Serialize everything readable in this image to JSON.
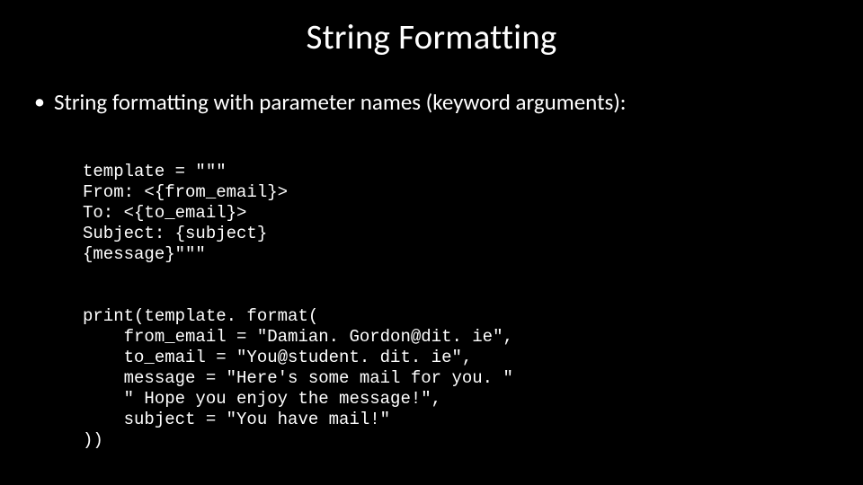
{
  "title": "String Formatting",
  "bullet": "String formatting with parameter names (keyword arguments):",
  "code": {
    "l1": "template = \"\"\"",
    "l2": "From: <{from_email}>",
    "l3": "To: <{to_email}>",
    "l4": "Subject: {subject}",
    "l5": "{message}\"\"\"",
    "l6": "print(template. format(",
    "l7": "    from_email = \"Damian. Gordon@dit. ie\",",
    "l8": "    to_email = \"You@student. dit. ie\",",
    "l9": "    message = \"Here's some mail for you. \"",
    "l10": "    \" Hope you enjoy the message!\",",
    "l11": "    subject = \"You have mail!\"",
    "l12": "))"
  }
}
